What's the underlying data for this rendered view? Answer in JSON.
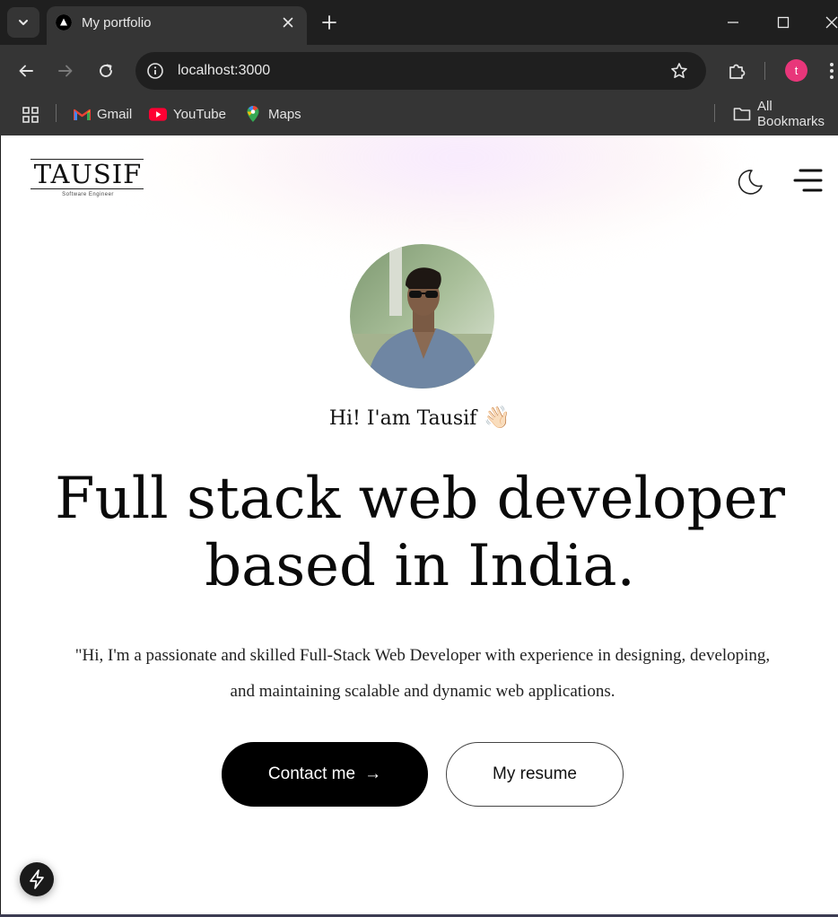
{
  "browser": {
    "tab_title": "My portfolio",
    "url": "localhost:3000",
    "profile_initial": "t",
    "bookmarks": [
      {
        "label": "Gmail",
        "icon": "gmail-icon"
      },
      {
        "label": "YouTube",
        "icon": "youtube-icon"
      },
      {
        "label": "Maps",
        "icon": "maps-icon"
      }
    ],
    "all_bookmarks_label": "All Bookmarks"
  },
  "site": {
    "logo_name": "TAUSIF",
    "logo_tagline": "Software Engineer",
    "greeting": "Hi! I'am Tausif",
    "greeting_emoji": "👋🏻",
    "headline_line1": "Full stack web developer",
    "headline_line2": "based in India.",
    "intro": "\"Hi, I'm a passionate and skilled Full-Stack Web Developer with experience in designing, developing, and maintaining scalable and dynamic web applications.",
    "contact_label": "Contact me",
    "contact_arrow": "→",
    "resume_label": "My resume"
  },
  "colors": {
    "chrome_dark": "#1f1f1f",
    "chrome_mid": "#353535",
    "profile_pink": "#e8367a",
    "button_black": "#000000"
  }
}
